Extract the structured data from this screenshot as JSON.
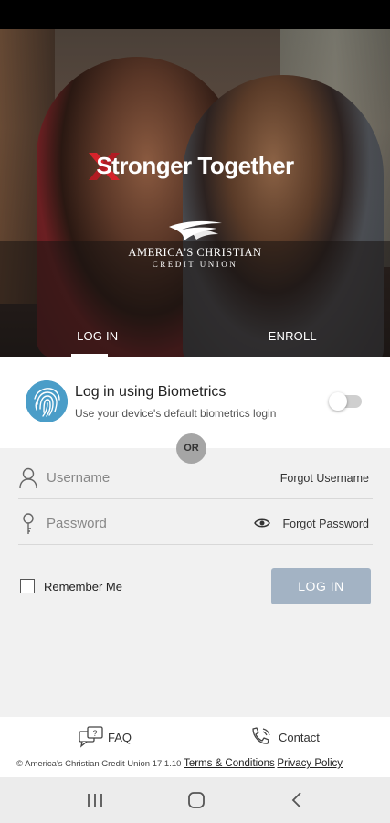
{
  "hero": {
    "tagline": "Stronger Together",
    "logo_line1": "AMERICA'S CHRISTIAN",
    "logo_line2": "CREDIT UNION"
  },
  "tabs": [
    {
      "label": "LOG IN",
      "active": true
    },
    {
      "label": "ENROLL",
      "active": false
    }
  ],
  "biometrics": {
    "title": "Log in using Biometrics",
    "subtitle": "Use your device's default biometrics login",
    "enabled": false
  },
  "divider_label": "OR",
  "username": {
    "placeholder": "Username",
    "link": "Forgot Username"
  },
  "password": {
    "placeholder": "Password",
    "link": "Forgot Password"
  },
  "remember": {
    "label": "Remember Me",
    "checked": false
  },
  "login_button": "LOG IN",
  "footer": {
    "faq": "FAQ",
    "contact": "Contact",
    "copyright": "© America's Christian Credit Union 17.1.10",
    "terms": "Terms & Conditions",
    "privacy": "Privacy Policy"
  },
  "colors": {
    "accent_red": "#d6232b",
    "fingerprint_blue": "#4a9dc8",
    "login_button": "#a3b3c4"
  },
  "icons": {
    "nav_recent": "recent-apps-icon",
    "nav_home": "home-icon",
    "nav_back": "back-icon"
  }
}
